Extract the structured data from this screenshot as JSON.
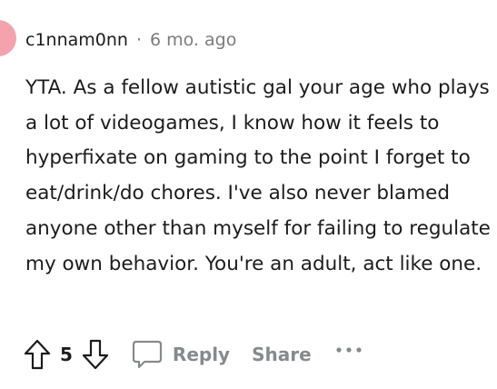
{
  "comment": {
    "author": "c1nnam0nn",
    "separator": "·",
    "timestamp": "6 mo. ago",
    "body": "YTA. As a fellow autistic gal your age who plays a lot of videogames, I know how it feels to hyperfixate on gaming to the point I forget to eat/drink/do chores. I've also never blamed anyone other than myself for failing to regulate my own behavior. You're an adult, act like one."
  },
  "actions": {
    "upvote_icon": "arrow-up-icon",
    "vote_count": "5",
    "downvote_icon": "arrow-down-icon",
    "reply_icon": "speech-bubble-icon",
    "reply_label": "Reply",
    "share_label": "Share",
    "more_icon": "ellipsis-icon"
  },
  "colors": {
    "avatar": "#f4a2ad",
    "text": "#1c1c1c",
    "muted": "#7c7c7c",
    "action_gray": "#878a8c"
  }
}
